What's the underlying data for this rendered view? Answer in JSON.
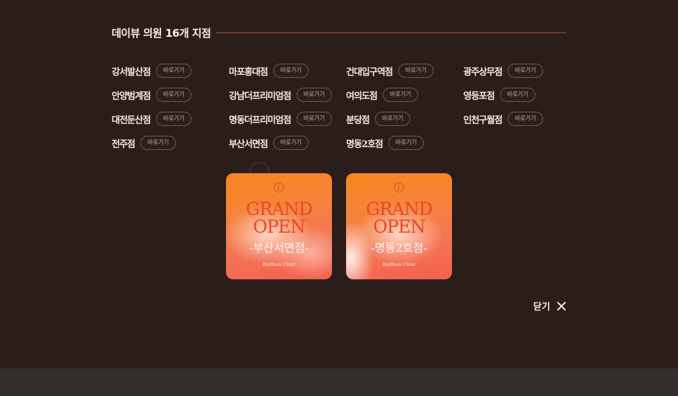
{
  "header": {
    "title": "데이뷰 의원 16개 지점"
  },
  "goto_label": "바로가기",
  "branches": [
    [
      "강서발산점",
      "마포홍대점",
      "건대입구역점",
      "광주상무점"
    ],
    [
      "안양범계점",
      "강남더프리미엄점",
      "여의도점",
      "영등포점"
    ],
    [
      "대전둔산점",
      "명동더프리미엄점",
      "분당점",
      "인천구월점"
    ],
    [
      "전주점",
      "부산서면점",
      "명동2호점"
    ]
  ],
  "cards": [
    {
      "headline_1": "GRAND",
      "headline_2": "OPEN",
      "branch": "-부산서면점-",
      "brand": "DayBeau Clinic"
    },
    {
      "headline_1": "GRAND",
      "headline_2": "OPEN",
      "branch": "-명동2호점-",
      "brand": "DayBeau Clinic"
    }
  ],
  "close": {
    "label": "닫기"
  },
  "colors": {
    "background": "#2b1e1a",
    "accent_line": "#9b5a3a",
    "card_orange": "#f5871e"
  }
}
